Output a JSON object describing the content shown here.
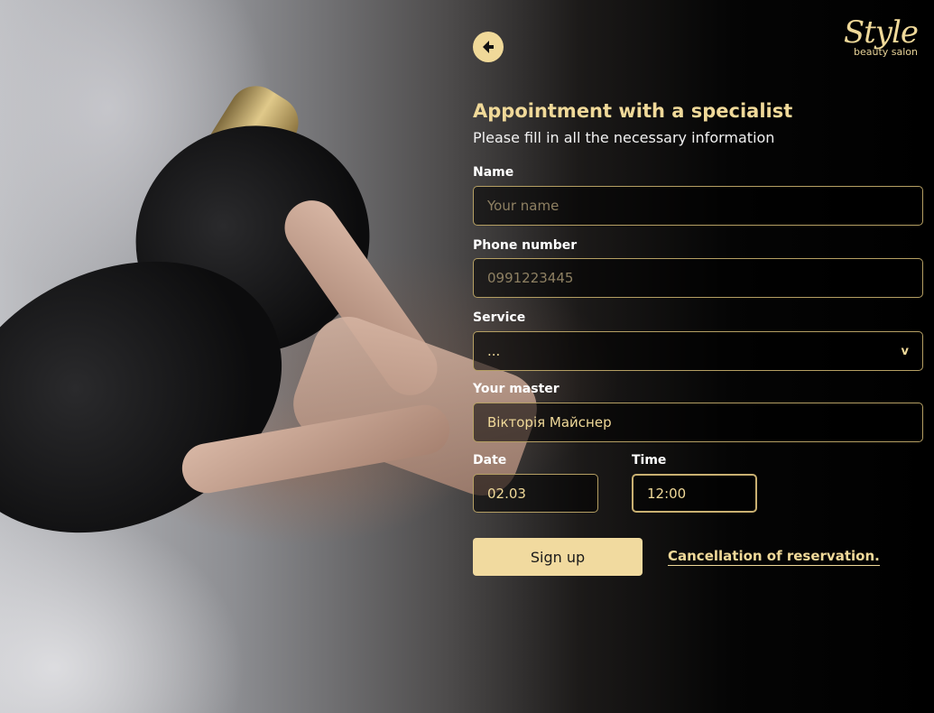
{
  "brand": {
    "name": "Style",
    "tagline": "beauty salon"
  },
  "header": {
    "back_icon": "back-arrow-icon"
  },
  "form": {
    "title": "Appointment with a specialist",
    "subtitle": "Please fill in all the necessary information",
    "name": {
      "label": "Name",
      "placeholder": "Your name"
    },
    "phone": {
      "label": "Phone number",
      "placeholder": "0991223445"
    },
    "service": {
      "label": "Service",
      "value": "...",
      "chevron": "v"
    },
    "master": {
      "label": "Your master",
      "value": "Вікторія Майснер"
    },
    "date": {
      "label": "Date",
      "value": "02.03"
    },
    "time": {
      "label": "Time",
      "value": "12:00"
    },
    "submit_label": "Sign up",
    "cancel_link": "Cancellation of reservation."
  },
  "colors": {
    "accent": "#f0d999",
    "field_border": "#b59f63",
    "button_bg": "#f1da9f"
  }
}
